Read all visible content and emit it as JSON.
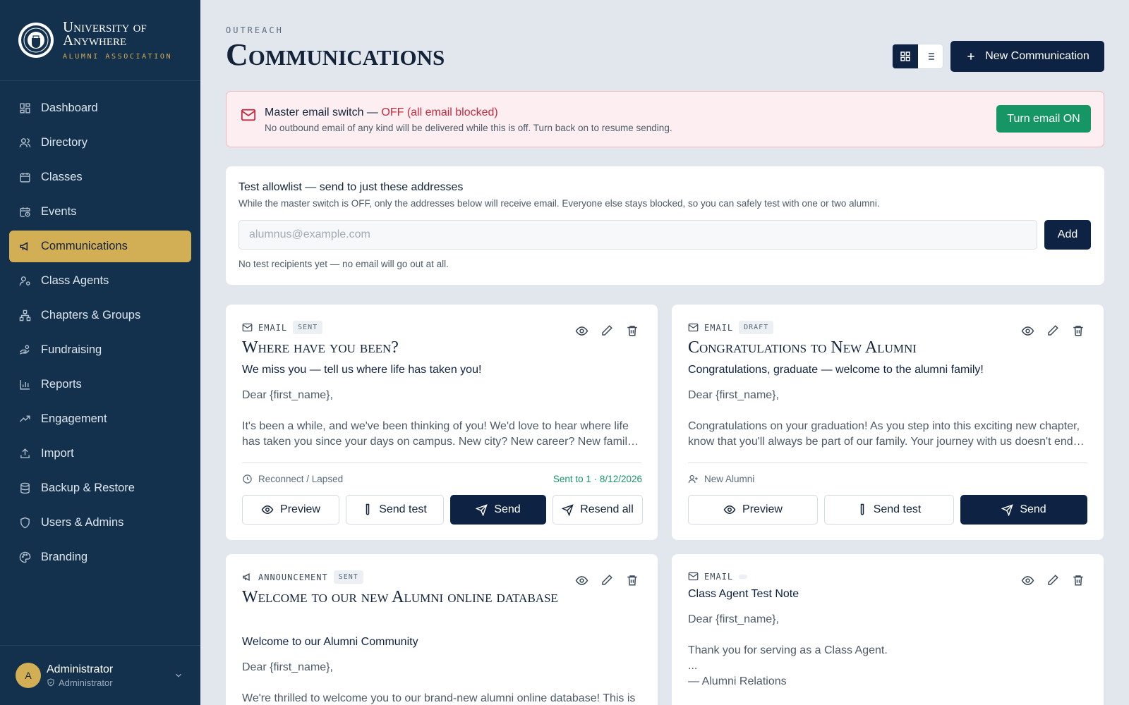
{
  "brand": {
    "name": "University of Anywhere",
    "subtitle": "Alumni Association"
  },
  "nav": [
    {
      "label": "Dashboard",
      "icon": "grid-icon",
      "active": false
    },
    {
      "label": "Directory",
      "icon": "users-icon",
      "active": false
    },
    {
      "label": "Classes",
      "icon": "calendar-icon",
      "active": false
    },
    {
      "label": "Events",
      "icon": "calendar-clock-icon",
      "active": false
    },
    {
      "label": "Communications",
      "icon": "megaphone-icon",
      "active": true
    },
    {
      "label": "Class Agents",
      "icon": "user-cog-icon",
      "active": false
    },
    {
      "label": "Chapters & Groups",
      "icon": "network-icon",
      "active": false
    },
    {
      "label": "Fundraising",
      "icon": "hand-coins-icon",
      "active": false
    },
    {
      "label": "Reports",
      "icon": "bar-chart-icon",
      "active": false
    },
    {
      "label": "Engagement",
      "icon": "trending-up-icon",
      "active": false
    },
    {
      "label": "Import",
      "icon": "upload-icon",
      "active": false
    },
    {
      "label": "Backup & Restore",
      "icon": "database-icon",
      "active": false
    },
    {
      "label": "Users & Admins",
      "icon": "shield-icon",
      "active": false
    },
    {
      "label": "Branding",
      "icon": "palette-icon",
      "active": false
    }
  ],
  "user": {
    "initial": "A",
    "name": "Administrator",
    "role": "Administrator"
  },
  "header": {
    "eyebrow": "OUTREACH",
    "title": "Communications",
    "new_button": "New Communication"
  },
  "alert": {
    "title_prefix": "Master email switch — ",
    "status": "OFF (all email blocked)",
    "subtitle": "No outbound email of any kind will be delivered while this is off. Turn back on to resume sending.",
    "button": "Turn email ON"
  },
  "allowlist": {
    "title": "Test allowlist — send to just these addresses",
    "subtitle": "While the master switch is OFF, only the addresses below will receive email. Everyone else stays blocked, so you can safely test with one or two alumni.",
    "placeholder": "alumnus@example.com",
    "add_button": "Add",
    "empty_note": "No test recipients yet — no email will go out at all."
  },
  "cards": [
    {
      "type": "EMAIL",
      "status": "SENT",
      "title": "Where have you been?",
      "subject": "We miss you — tell us where life has taken you!",
      "greeting": "Dear {first_name},",
      "body_line1": "It's been a while, and we've been thinking of you! We'd love to hear where life",
      "body_line2": "has taken you since your days on campus. New city? New career? New family…",
      "audience": "Reconnect / Lapsed",
      "sent_info": "Sent to 1 · 8/12/2026",
      "buttons": {
        "preview": "Preview",
        "send_test": "Send test",
        "send": "Send",
        "resend": "Resend all"
      }
    },
    {
      "type": "EMAIL",
      "status": "DRAFT",
      "title": "Congratulations to New Alumni",
      "subject": "Congratulations, graduate — welcome to the alumni family!",
      "greeting": "Dear {first_name},",
      "body_line1": "Congratulations on your graduation! As you step into this exciting new chapter,",
      "body_line2": "know that you'll always be part of our family. Your journey with us doesn't end…",
      "audience": "New Alumni",
      "buttons": {
        "preview": "Preview",
        "send_test": "Send test",
        "send": "Send"
      }
    },
    {
      "type": "ANNOUNCEMENT",
      "status": "SENT",
      "title": "Welcome to our new Alumni online database",
      "subject": "Welcome to our Alumni Community",
      "greeting": "Dear {first_name},",
      "body_line1": "We're thrilled to welcome you to our brand-new alumni online database! This is"
    },
    {
      "type": "EMAIL",
      "status": "",
      "subject": "Class Agent Test Note",
      "greeting": "Dear {first_name},",
      "body_line1": "Thank you for serving as a Class Agent.",
      "body_line2": "...",
      "body_line3": "— Alumni Relations"
    }
  ],
  "colors": {
    "sidebar": "#13314c",
    "accent_gold": "#d2ae55",
    "navy": "#0e2244",
    "danger": "#c62a3e",
    "success": "#169665"
  }
}
